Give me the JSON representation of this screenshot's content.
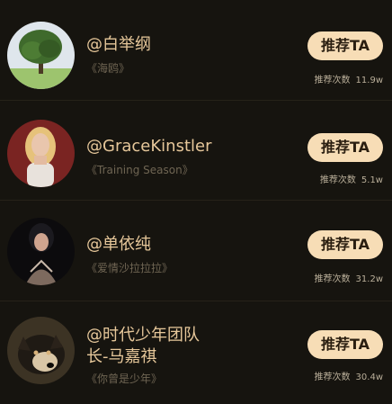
{
  "colors": {
    "background": "#16140f",
    "name_text": "#e6c79a",
    "subtitle_text": "#6f6553",
    "button_bg": "#f7ddb6",
    "button_text": "#2a1e10",
    "count_text": "#b9ae99"
  },
  "items": [
    {
      "avatar_icon": "tree-avatar",
      "name": "@白举纲",
      "work": "《海鸥》",
      "button_label": "推荐TA",
      "count_label": "推荐次数",
      "count_value": "11.9w"
    },
    {
      "avatar_icon": "portrait-avatar",
      "name": "@GraceKinstler",
      "work": "《Training Season》",
      "button_label": "推荐TA",
      "count_label": "推荐次数",
      "count_value": "5.1w"
    },
    {
      "avatar_icon": "portrait-avatar",
      "name": "@单依纯",
      "work": "《爱情沙拉拉拉》",
      "button_label": "推荐TA",
      "count_label": "推荐次数",
      "count_value": "31.2w"
    },
    {
      "avatar_icon": "dog-avatar",
      "name_line1": "@时代少年团队",
      "name_line2": "长-马嘉祺",
      "work": "《你曾是少年》",
      "button_label": "推荐TA",
      "count_label": "推荐次数",
      "count_value": "30.4w"
    }
  ]
}
